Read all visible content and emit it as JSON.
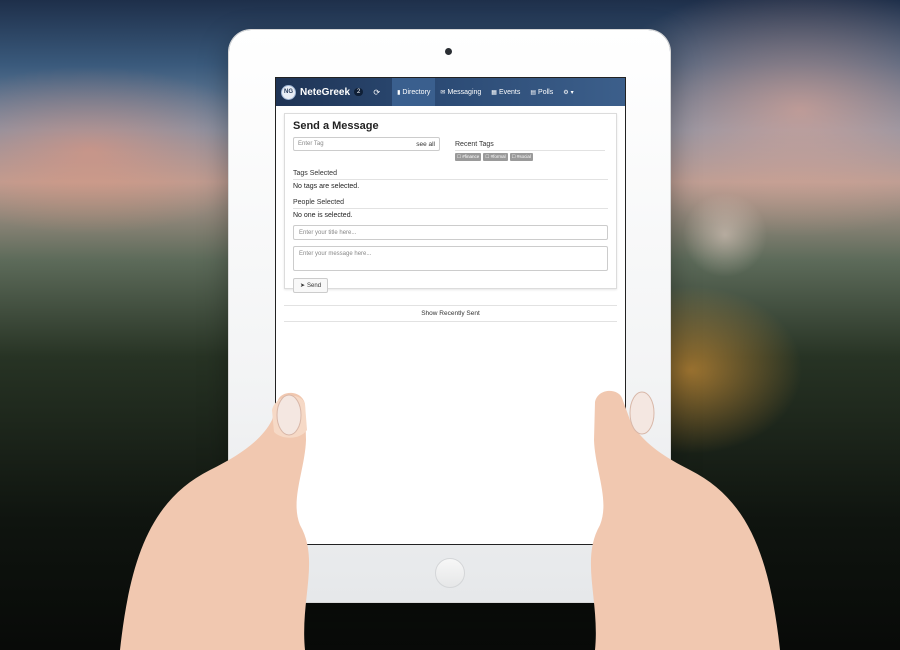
{
  "navbar": {
    "logo_text": "NG",
    "brand": "NeteGreek",
    "badge_count": "2",
    "items": [
      {
        "label": "Directory",
        "icon": "book-icon"
      },
      {
        "label": "Messaging",
        "icon": "envelope-icon"
      },
      {
        "label": "Events",
        "icon": "calendar-icon"
      },
      {
        "label": "Polls",
        "icon": "table-icon"
      }
    ]
  },
  "compose": {
    "title": "Send a Message",
    "tag_placeholder": "Enter Tag",
    "see_all": "see all",
    "recent_tags_label": "Recent Tags",
    "recent_tags": [
      "#finance",
      "#formal",
      "#social"
    ],
    "tags_selected_label": "Tags Selected",
    "tags_selected_value": "No tags are selected.",
    "people_selected_label": "People Selected",
    "people_selected_value": "No one is selected.",
    "title_placeholder": "Enter your title here...",
    "message_placeholder": "Enter your message here...",
    "send_label": "Send"
  },
  "recent_sent_label": "Show Recently Sent"
}
